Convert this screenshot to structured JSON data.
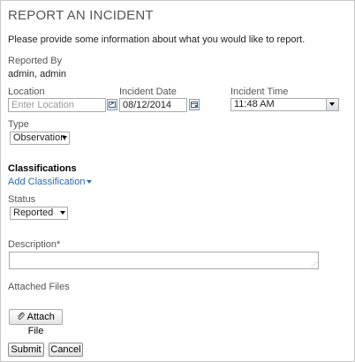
{
  "page": {
    "title": "REPORT AN INCIDENT",
    "intro": "Please provide some information about what you would like to report."
  },
  "reported_by": {
    "label": "Reported By",
    "value": "admin, admin"
  },
  "location": {
    "label": "Location",
    "placeholder": "Enter Location"
  },
  "incident_date": {
    "label": "Incident Date",
    "value": "08/12/2014"
  },
  "incident_time": {
    "label": "Incident Time",
    "value": "11:48 AM"
  },
  "type": {
    "label": "Type",
    "value": "Observation"
  },
  "classifications": {
    "heading": "Classifications",
    "add_link": "Add Classification"
  },
  "status": {
    "label": "Status",
    "value": "Reported"
  },
  "description": {
    "label": "Description*"
  },
  "attached_files": {
    "label": "Attached Files",
    "button": "Attach File"
  },
  "actions": {
    "submit": "Submit",
    "cancel": "Cancel"
  },
  "colors": {
    "link": "#2a6ab0",
    "border": "#a9a9a9"
  }
}
